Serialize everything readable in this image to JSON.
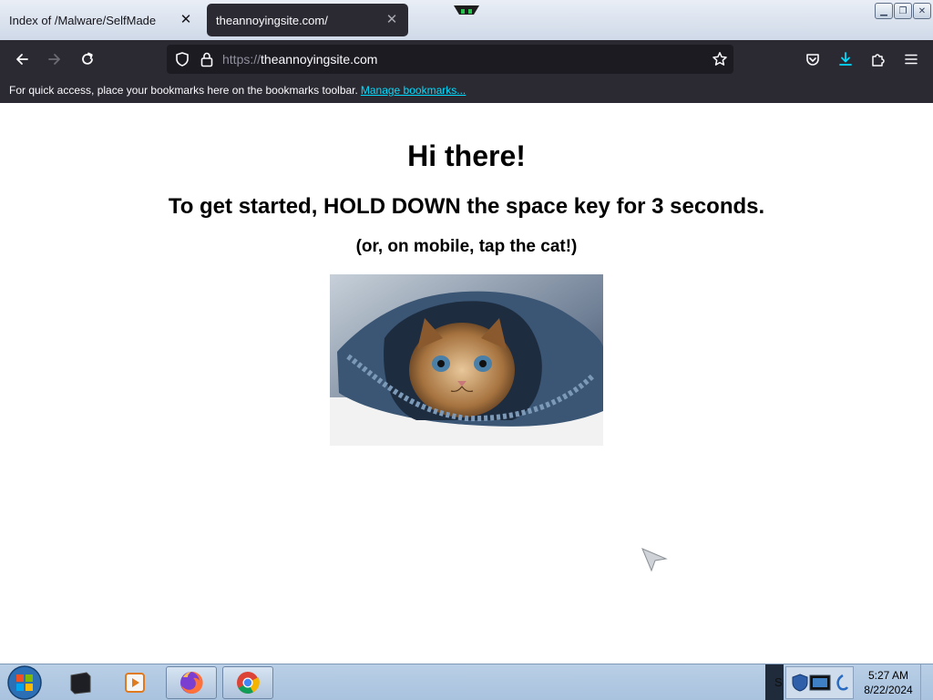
{
  "browser": {
    "tabs": [
      {
        "title": "Index of /Malware/SelfMade",
        "active": false
      },
      {
        "title": "theannoyingsite.com/",
        "active": true
      }
    ],
    "url": {
      "scheme": "https://",
      "host": "theannoyingsite.com"
    },
    "bookmarks_bar": {
      "message": "For quick access, place your bookmarks here on the bookmarks toolbar.",
      "link": "Manage bookmarks..."
    },
    "icons": {
      "back": "arrow-left-icon",
      "forward": "arrow-right-icon",
      "reload": "reload-icon",
      "shield": "tracking-protection-shield-icon",
      "lock": "padlock-icon",
      "bookmark_star": "star-icon",
      "pocket": "pocket-icon",
      "downloads": "download-icon",
      "extensions": "puzzle-piece-icon",
      "menu": "hamburger-menu-icon"
    },
    "colors": {
      "toolbar": "#2b2a33",
      "urlbar": "#1c1b22",
      "link": "#00ddff",
      "download_accent": "#00ddff"
    }
  },
  "page": {
    "heading": "Hi there!",
    "instruction": "To get started, HOLD DOWN the space key for 3 seconds.",
    "mobile_hint": "(or, on mobile, tap the cat!)",
    "image": "kitten-in-denim-photo"
  },
  "taskbar": {
    "clock": {
      "time": "5:27 AM",
      "date": "8/22/2024"
    },
    "tray_text": "S",
    "items": [
      "start-orb",
      "terminal-app",
      "media-player",
      "firefox",
      "chrome"
    ]
  }
}
